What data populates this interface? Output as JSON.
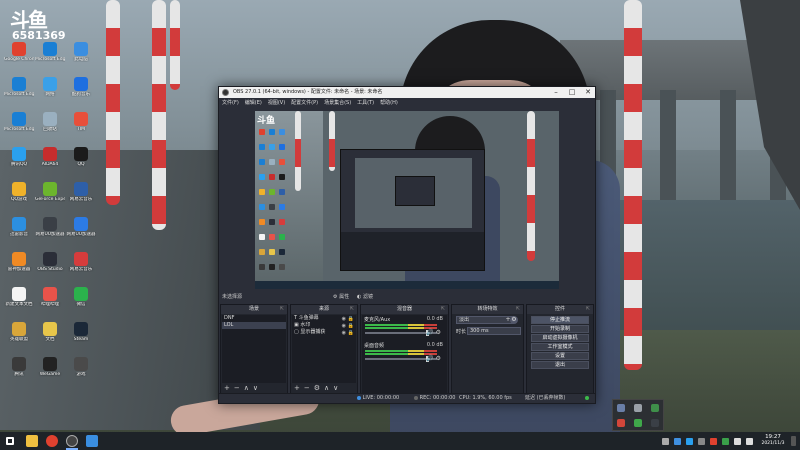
{
  "desktop": {
    "logo": {
      "mark": "斗鱼",
      "room_number": "6581369"
    },
    "icons": [
      {
        "label": "Google Chrome",
        "color": "#e0412f"
      },
      {
        "label": "Microsoft Edge",
        "color": "#1a7fd4"
      },
      {
        "label": "此电脑",
        "color": "#3b8ee0"
      },
      {
        "label": "Microsoft Edge",
        "color": "#1a7fd4"
      },
      {
        "label": "网络",
        "color": "#3aa0e8"
      },
      {
        "label": "酷狗音乐",
        "color": "#1e6fe0"
      },
      {
        "label": "Microsoft Edge",
        "color": "#1a7fd4"
      },
      {
        "label": "回收站",
        "color": "#9ab0c0"
      },
      {
        "label": "TIM",
        "color": "#e84f3a"
      },
      {
        "label": "腾讯QQ",
        "color": "#2aa0ef"
      },
      {
        "label": "AIDA64",
        "color": "#c62d2d"
      },
      {
        "label": "QQ",
        "color": "#1b1b1b"
      },
      {
        "label": "QQ游戏",
        "color": "#f0b22a"
      },
      {
        "label": "GeForce Experience",
        "color": "#6cb52d"
      },
      {
        "label": "网易云音乐",
        "color": "#2e5fa8"
      },
      {
        "label": "迅雷影音",
        "color": "#2c8fe0"
      },
      {
        "label": "网易UU加速器",
        "color": "#3a3f46"
      },
      {
        "label": "网易UU加速器",
        "color": "#2c7be5"
      },
      {
        "label": "雷神加速器",
        "color": "#f08a24"
      },
      {
        "label": "OBS Studio",
        "color": "#2b2e38"
      },
      {
        "label": "网易云音乐",
        "color": "#d63c3c"
      },
      {
        "label": "新建文本文档",
        "color": "#f4f4f4"
      },
      {
        "label": "哔哩哔哩",
        "color": "#e8534a"
      },
      {
        "label": "微信",
        "color": "#2bb24c"
      },
      {
        "label": "英雄联盟",
        "color": "#d9a63a"
      },
      {
        "label": "文档",
        "color": "#e8c64a"
      },
      {
        "label": "Steam",
        "color": "#1b2838"
      },
      {
        "label": "腾讯",
        "color": "#3a3a3a"
      },
      {
        "label": "WeGame",
        "color": "#222222"
      },
      {
        "label": "游戏",
        "color": "#4a4a4a"
      }
    ]
  },
  "obs": {
    "title": "OBS 27.0.1 (64-bit, windows) - 配置文件: 未命名 - 场景: 未命名",
    "window_controls": {
      "minimize": "–",
      "maximize": "□",
      "close": "✕"
    },
    "menu": [
      "文件(F)",
      "编辑(E)",
      "视图(V)",
      "配置文件(P)",
      "场景集合(S)",
      "工具(T)",
      "帮助(H)"
    ],
    "toolbar": {
      "current_scene_label": "未选择源",
      "properties": "属性",
      "filters": "滤镜"
    },
    "scenes": {
      "header": "场景",
      "items": [
        "DNF",
        "LOL"
      ],
      "selected_index": 1,
      "footer": [
        "+",
        "−",
        "∧",
        "∨"
      ]
    },
    "sources": {
      "header": "来源",
      "items": [
        {
          "name": "斗鱼弹幕",
          "icon": "T"
        },
        {
          "name": "水印",
          "icon": "▣"
        },
        {
          "name": "显示器捕获",
          "icon": "▢"
        }
      ],
      "footer": [
        "+",
        "−",
        "⚙",
        "∧",
        "∨"
      ]
    },
    "mixer": {
      "header": "混音器",
      "channels": [
        {
          "name": "麦克风/Aux",
          "db": "0.0 dB"
        },
        {
          "name": "桌面音频",
          "db": "0.0 dB"
        }
      ]
    },
    "transitions": {
      "header": "转场特效",
      "type": "淡出",
      "duration_label": "时长",
      "duration_value": "300 ms"
    },
    "controls": {
      "header": "控件",
      "buttons": [
        "停止推流",
        "开始录制",
        "启动虚拟摄像机",
        "工作室模式",
        "设置",
        "退出"
      ]
    },
    "status": {
      "live_label": "LIVE:",
      "live_time": "00:00:00",
      "rec_label": "REC:",
      "rec_time": "00:00:00",
      "cpu": "CPU: 1.9%, 60.00 fps",
      "extra": "延迟 (已丢弃帧数)"
    }
  },
  "taskbar": {
    "apps": [
      {
        "name": "start",
        "color": "#ffffff"
      },
      {
        "name": "file-explorer",
        "color": "#f0c040"
      },
      {
        "name": "chrome",
        "color": "#e0412f"
      },
      {
        "name": "obs",
        "color": "#444444"
      },
      {
        "name": "settings",
        "color": "#3a8ee0"
      }
    ],
    "clock_time": "19:27",
    "clock_date": "2021/11/3"
  }
}
